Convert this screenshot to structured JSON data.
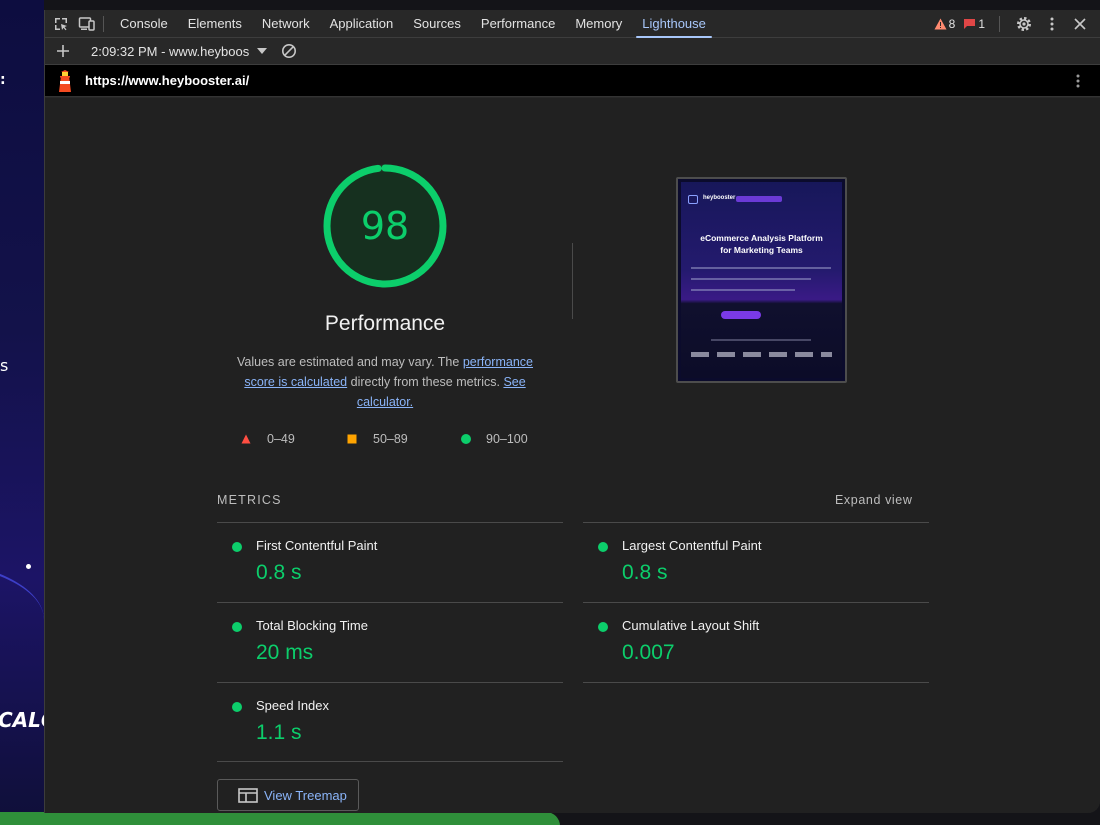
{
  "page_strip": {
    "text_fragments": [
      ":",
      "s",
      "CALC"
    ]
  },
  "devtools": {
    "tabs": [
      {
        "label": "Console"
      },
      {
        "label": "Elements"
      },
      {
        "label": "Network"
      },
      {
        "label": "Application"
      },
      {
        "label": "Sources"
      },
      {
        "label": "Performance"
      },
      {
        "label": "Memory"
      },
      {
        "label": "Lighthouse",
        "active": true
      }
    ],
    "warnings_count": "8",
    "errors_count": "1",
    "report_selector": "2:09:32 PM - www.heyboos",
    "url": "https://www.heybooster.ai/"
  },
  "report": {
    "score": "98",
    "score_fraction": 0.98,
    "title": "Performance",
    "desc_prefix": "Values are estimated and may vary. The ",
    "desc_link1": "performance score is calculated",
    "desc_middle": " directly from these metrics. ",
    "desc_link2": "See calculator.",
    "legend": [
      {
        "label": "0–49",
        "color": "#ff4e42"
      },
      {
        "label": "50–89",
        "color": "#ffa400"
      },
      {
        "label": "90–100",
        "color": "#0cce6b"
      }
    ],
    "screenshot": {
      "brand": "heybooster",
      "headline_line1": "eCommerce Analysis Platform",
      "headline_line2": "for Marketing Teams"
    },
    "metrics_title": "METRICS",
    "expand_label": "Expand view",
    "metrics": [
      {
        "label": "First Contentful Paint",
        "value": "0.8 s"
      },
      {
        "label": "Largest Contentful Paint",
        "value": "0.8 s"
      },
      {
        "label": "Total Blocking Time",
        "value": "20 ms"
      },
      {
        "label": "Cumulative Layout Shift",
        "value": "0.007"
      },
      {
        "label": "Speed Index",
        "value": "1.1 s"
      }
    ],
    "treemap_label": "View Treemap"
  },
  "colors": {
    "pass": "#0cce6b",
    "link": "#8ab4f8",
    "accent_tab": "#a8c7fa"
  }
}
